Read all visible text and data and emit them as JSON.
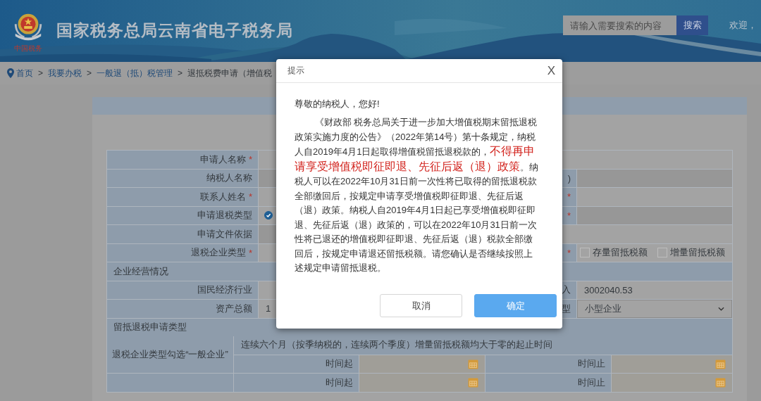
{
  "header": {
    "logo_text": "中国税务",
    "site_title": "国家税务总局云南省电子税务局",
    "search": {
      "placeholder": "请输入需要搜索的内容",
      "button": "搜索"
    },
    "welcome": "欢迎，"
  },
  "breadcrumb": {
    "items": [
      "首页",
      "我要办税",
      "一般退（抵）税管理",
      "退抵税费申请（增值税"
    ],
    "separators": [
      ">",
      ">",
      ">"
    ]
  },
  "form": {
    "rows": [
      {
        "kind": "field",
        "label": "申请人名称",
        "required_mark": "*",
        "middle": {
          "kind": "input",
          "disabled": false
        },
        "right": {
          "kind": "input",
          "disabled": false
        }
      },
      {
        "kind": "field",
        "label": "纳税人名称",
        "middle": {
          "kind": "input",
          "disabled": true
        },
        "right": {
          "label": ")",
          "kind": "input",
          "disabled": true
        }
      },
      {
        "kind": "field",
        "label": "联系人姓名",
        "required_mark": "*",
        "middle": {
          "kind": "input",
          "disabled": false
        },
        "right": {
          "required_mark": "*",
          "kind": "input",
          "disabled": false
        }
      },
      {
        "kind": "field",
        "label": "申请退税类型",
        "middle": {
          "kind": "radio",
          "checked": true
        },
        "right": {
          "required_mark": "*",
          "kind": "input",
          "disabled": true
        }
      },
      {
        "kind": "field",
        "label": "申请文件依据",
        "middle": {
          "kind": "input",
          "disabled": true
        },
        "right": {
          "kind": "input",
          "disabled": false
        }
      },
      {
        "kind": "field",
        "label": "退税企业类型",
        "required_mark": "*",
        "middle": {
          "kind": "input",
          "disabled": false
        },
        "right": {
          "required_mark": "*",
          "kind": "checkboxes",
          "options": [
            {
              "label": "存量留抵税额",
              "checked": false
            },
            {
              "label": "增量留抵税额",
              "checked": false
            }
          ]
        }
      },
      {
        "kind": "section",
        "title": "企业经营情况"
      },
      {
        "kind": "field",
        "label": "国民经济行业",
        "middle": {
          "kind": "input",
          "disabled": false
        },
        "right": {
          "label": "入",
          "kind": "input",
          "value": "3002040.53",
          "disabled": false
        }
      },
      {
        "kind": "field",
        "label": "资产总额",
        "middle": {
          "kind": "input",
          "value": "1",
          "disabled": false
        },
        "right": {
          "label": "型",
          "kind": "select",
          "value": "小型企业"
        }
      },
      {
        "kind": "section",
        "title": "留抵退税申请类型"
      }
    ],
    "period_groups": [
      {
        "label": "退税企业类型勾选“一般企业”",
        "lines": [
          {
            "kind": "note",
            "text": "连续六个月（按季纳税的，连续两个季度）增量留抵税额均大于零的起止时间"
          },
          {
            "kind": "range",
            "start_label": "时间起",
            "end_label": "时间止"
          }
        ]
      },
      {
        "lines": [
          {
            "kind": "range",
            "start_label": "时间起",
            "end_label": "时间止"
          }
        ]
      }
    ]
  },
  "dialog": {
    "title": "提示",
    "close": "X",
    "greeting": "尊敬的纳税人，您好!",
    "body": "《财政部 税务总局关于进一步加大增值税期末留抵退税政策实施力度的公告》（2022年第14号）第十条规定，纳税人自2019年4月1日起取得增值税留抵退税款的，**不得再申请享受增值税即征即退、先征后返（退）政策**。纳税人可以在2022年10月31日前一次性将已取得的留抵退税款全部缴回后，按规定申请享受增值税即征即退、先征后返（退）政策。纳税人自2019年4月1日起已享受增值税即征即退、先征后返（退）政策的，可以在2022年10月31日前一次性将已退还的增值税即征即退、先征后返（退）税款全部缴回后，按规定申请退还留抵税额。请您确认是否继续按照上述规定申请留抵退税。",
    "buttons": [
      {
        "label": "取消",
        "kind": "secondary"
      },
      {
        "label": "确定",
        "kind": "primary"
      }
    ]
  }
}
